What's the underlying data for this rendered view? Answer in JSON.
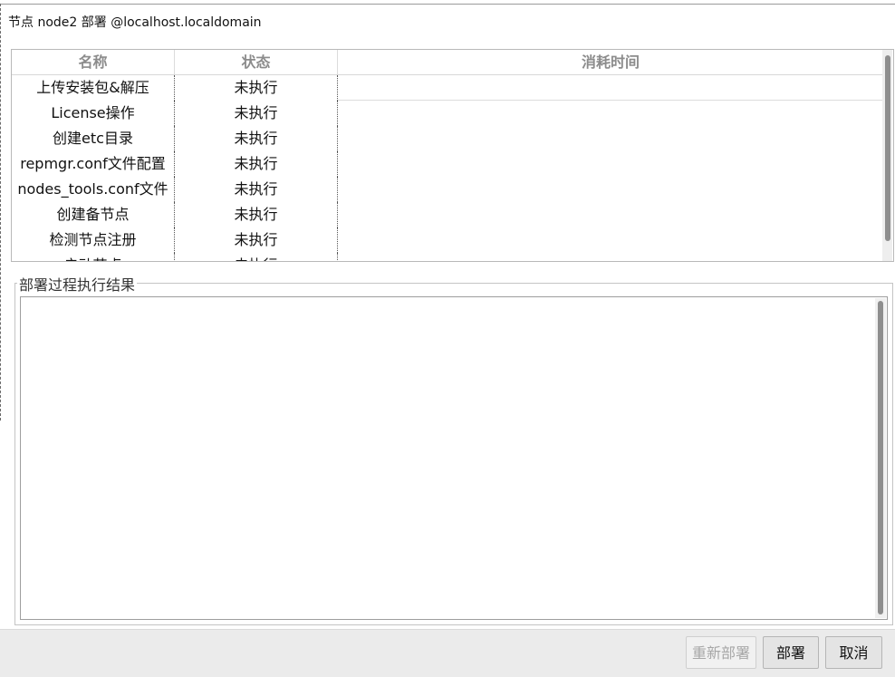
{
  "window": {
    "title": "节点 node2 部署 @localhost.localdomain"
  },
  "steps_table": {
    "columns": [
      "名称",
      "状态",
      "消耗时间"
    ],
    "rows": [
      {
        "name": "上传安装包&解压",
        "status": "未执行",
        "time": ""
      },
      {
        "name": "License操作",
        "status": "未执行",
        "time": ""
      },
      {
        "name": "创建etc目录",
        "status": "未执行",
        "time": ""
      },
      {
        "name": "repmgr.conf文件配置",
        "status": "未执行",
        "time": ""
      },
      {
        "name": "nodes_tools.conf文件",
        "status": "未执行",
        "time": ""
      },
      {
        "name": "创建备节点",
        "status": "未执行",
        "time": ""
      },
      {
        "name": "检测节点注册",
        "status": "未执行",
        "time": ""
      },
      {
        "name": "启动节点",
        "status": "未执行",
        "time": ""
      }
    ]
  },
  "result_group": {
    "title": "部署过程执行结果",
    "content": ""
  },
  "buttons": {
    "redeploy": "重新部署",
    "deploy": "部署",
    "cancel": "取消"
  }
}
